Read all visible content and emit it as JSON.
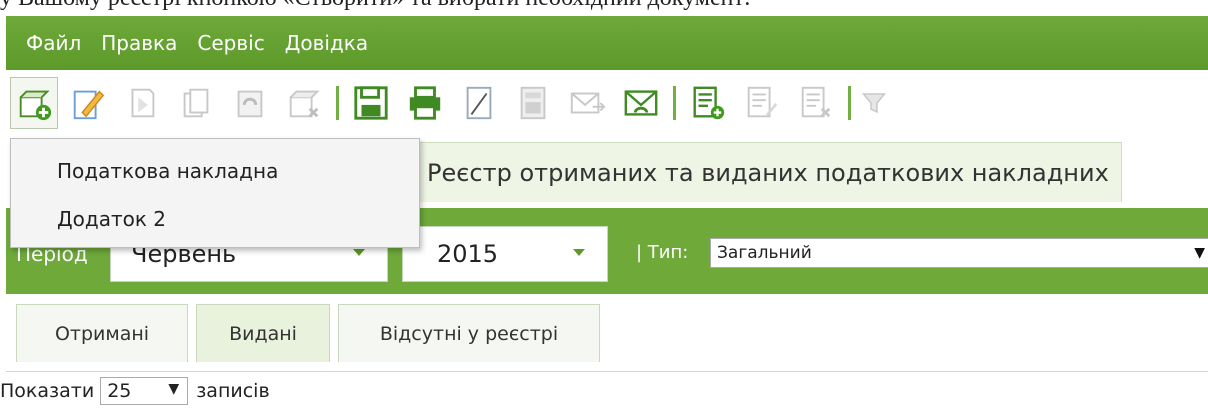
{
  "caption": "у Вашому реєстрі кнопкою «Створити» та вибрати необхідний документ:",
  "menu": [
    "Файл",
    "Правка",
    "Сервіс",
    "Довідка"
  ],
  "colors": {
    "accent_green": "#6ea93a",
    "close_orange": "#f39c12"
  },
  "toolbar": {
    "buttons": [
      {
        "icon": "create-doc-icon",
        "state": "active"
      },
      {
        "icon": "edit-pencil-icon",
        "state": "enabled"
      },
      {
        "icon": "open-doc-icon",
        "state": "disabled"
      },
      {
        "icon": "copy-doc-icon",
        "state": "disabled"
      },
      {
        "icon": "undo-doc-icon",
        "state": "disabled"
      },
      {
        "icon": "delete-doc-icon",
        "state": "disabled"
      },
      {
        "icon": "save-icon",
        "state": "enabled"
      },
      {
        "icon": "print-icon",
        "state": "enabled"
      },
      {
        "icon": "sign-icon",
        "state": "enabled"
      },
      {
        "icon": "calculator-icon",
        "state": "disabled"
      },
      {
        "icon": "send-mail-icon",
        "state": "disabled"
      },
      {
        "icon": "receive-mail-icon",
        "state": "enabled"
      },
      {
        "icon": "add-list-icon",
        "state": "enabled"
      },
      {
        "icon": "edit-list-icon",
        "state": "disabled"
      },
      {
        "icon": "delete-list-icon",
        "state": "disabled"
      },
      {
        "icon": "filter-icon",
        "state": "disabled"
      }
    ]
  },
  "document_tab": {
    "title": "Реєстр отриманих та виданих податкових накладних",
    "close": "×"
  },
  "filters": {
    "period_label": "Період",
    "month": "Червень",
    "year": "2015",
    "type_label": "| Тип:",
    "type_value": "Загальний",
    "caret": "▼"
  },
  "subtabs": [
    "Отримані",
    "Видані",
    "Відсутні у реєстрі"
  ],
  "show": {
    "prefix": "Показати",
    "value": "25",
    "suffix": "записів",
    "caret": "▼"
  },
  "create_menu": {
    "items": [
      "Податкова накладна",
      "Додаток 2"
    ]
  }
}
